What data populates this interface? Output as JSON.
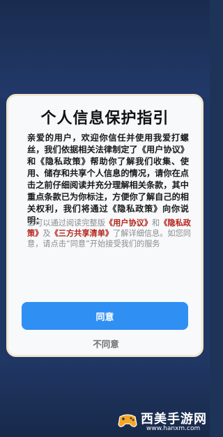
{
  "dialog": {
    "title": "个人信息保护指引",
    "body": "亲爱的用户，欢迎你信任并使用我爱打螺丝，我们依据相关法律制定了《用户协议》和《隐私政策》帮助你了解我们收集、使用、储存和共享个人信息的情况，请你在点击之前仔细阅读并充分理解相关条款，其中重点条款已为你标注，方便你了解自己的相关权利，我们将通过《隐私政策》向你说明：",
    "secondary": {
      "prefix": "您可以通过阅读完整版",
      "link_user_agreement": "《用户协议》",
      "and": "和",
      "link_privacy_policy": "《隐私政策》",
      "and2": "及",
      "link_sharing_list": "《三方共享清单》",
      "suffix": "了解详细信息。如您同意，请点击“同意”开始接受我们的服务"
    },
    "agree_label": "同意",
    "disagree_label": "不同意"
  },
  "watermark": {
    "brand": "西美手游网",
    "url": "www.hanxm.com"
  },
  "colors": {
    "background": "#203764",
    "dialog": "#f7f9fb",
    "dialog_border": "#f2e7cf",
    "accent_button": "#2f8ff3",
    "link": "#b5231b"
  }
}
